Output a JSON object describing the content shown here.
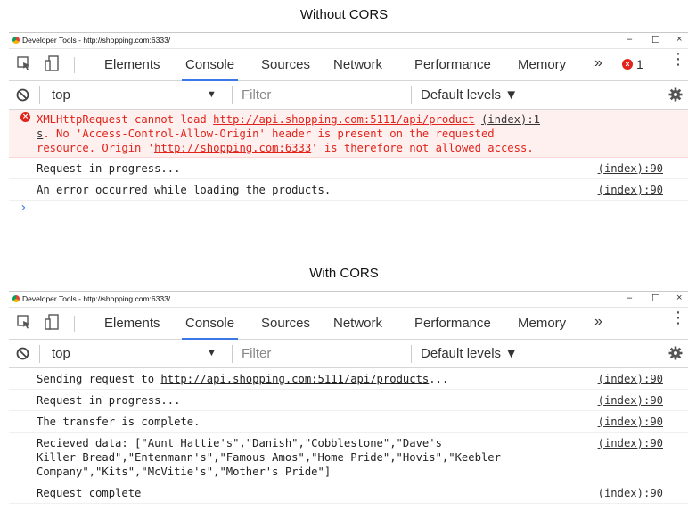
{
  "captions": {
    "without": "Without CORS",
    "with": "With CORS"
  },
  "window": {
    "title": "Developer Tools - http://shopping.com:6333/",
    "minimize": "–",
    "maximize": "☐",
    "close": "×"
  },
  "tabs": [
    "Elements",
    "Console",
    "Sources",
    "Network",
    "Performance",
    "Memory"
  ],
  "more_tabs": "»",
  "error_count": "1",
  "filterbar": {
    "context": "top",
    "filter_placeholder": "Filter",
    "levels": "Default levels ▼"
  },
  "without_cors": {
    "error": {
      "pre": "XMLHttpRequest cannot load ",
      "url": "http://api.shopping.com:5111/api/product",
      "source": "(index):1",
      "line2_start": "s",
      "mid": ". No 'Access-Control-Allow-Origin' header is present on the requested\nresource. Origin '",
      "origin": "http://shopping.com:6333",
      "post": "' is therefore not allowed access."
    },
    "logs": [
      {
        "msg": "Request in progress...",
        "source": "(index):90"
      },
      {
        "msg": "An error occurred while loading the products.",
        "source": "(index):90"
      }
    ],
    "prompt": "›"
  },
  "with_cors": {
    "logs": [
      {
        "pre": "Sending request to ",
        "url": "http://api.shopping.com:5111/api/products",
        "post": "...",
        "source": "(index):90"
      },
      {
        "msg": "Request in progress...",
        "source": "(index):90"
      },
      {
        "msg": "The transfer is complete.",
        "source": "(index):90"
      },
      {
        "msg": "Recieved data: [\"Aunt Hattie's\",\"Danish\",\"Cobblestone\",\"Dave's\nKiller Bread\",\"Entenmann's\",\"Famous Amos\",\"Home Pride\",\"Hovis\",\"Keebler\nCompany\",\"Kits\",\"McVitie's\",\"Mother's Pride\"]",
        "source": "(index):90"
      },
      {
        "msg": "Request complete",
        "source": "(index):90"
      }
    ]
  },
  "colors": {
    "error_text": "#e2231a",
    "error_bg": "#fff0f0",
    "active_tab": "#3b78e7"
  }
}
